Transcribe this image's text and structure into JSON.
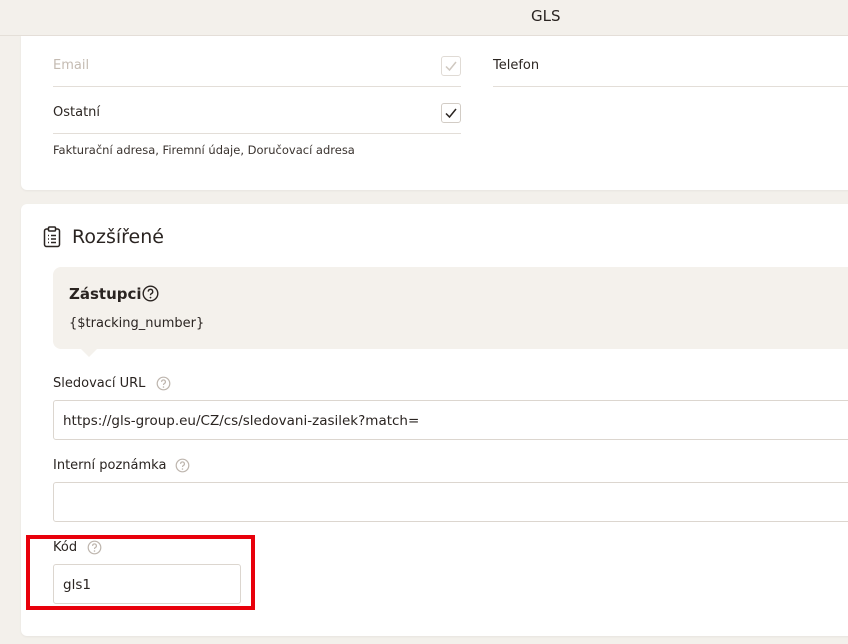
{
  "header": {
    "title": "GLS"
  },
  "contacts": {
    "email_label": "Email",
    "telefon_label": "Telefon",
    "ostatni_label": "Ostatní",
    "ostatni_hint": "Fakturační adresa, Firemní údaje, Doručovací adresa"
  },
  "extended": {
    "title": "Rozšířené",
    "placeholders_title": "Zástupci",
    "placeholders_value": "{$tracking_number}",
    "tracking_url_label": "Sledovací URL",
    "tracking_url_value": "https://gls-group.eu/CZ/cs/sledovani-zasilek?match=",
    "internal_note_label": "Interní poznámka",
    "internal_note_value": "",
    "code_label": "Kód",
    "code_value": "gls1"
  },
  "colors": {
    "accent_highlight": "#e8000b",
    "background": "#f3f0eb"
  }
}
